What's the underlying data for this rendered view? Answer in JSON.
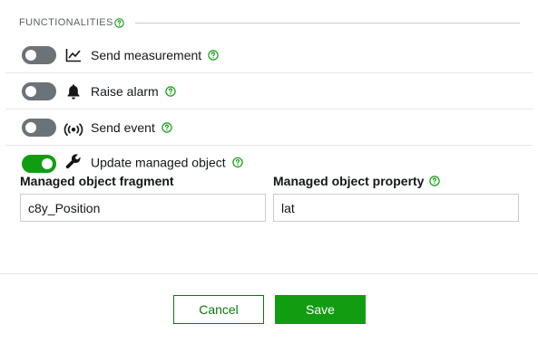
{
  "section": {
    "title": "FUNCTIONALITIES",
    "help_icon": "question-circle-icon"
  },
  "rows": [
    {
      "label": "Send measurement",
      "icon": "line-chart-icon",
      "enabled": false
    },
    {
      "label": "Raise alarm",
      "icon": "bell-icon",
      "enabled": false
    },
    {
      "label": "Send event",
      "icon": "broadcast-icon",
      "enabled": false
    },
    {
      "label": "Update managed object",
      "icon": "wrench-icon",
      "enabled": true
    }
  ],
  "fields": {
    "fragment": {
      "label": "Managed object fragment",
      "value": "c8y_Position"
    },
    "property": {
      "label": "Managed object property",
      "value": "lat"
    }
  },
  "buttons": {
    "cancel": "Cancel",
    "save": "Save"
  },
  "colors": {
    "accent": "#119d11",
    "toggle_off": "#6b7278",
    "help": "#119d11"
  }
}
